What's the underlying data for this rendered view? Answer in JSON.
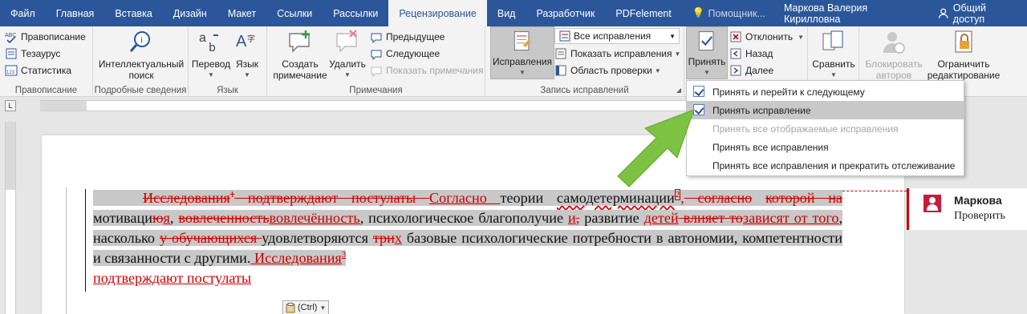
{
  "tabs": [
    "Файл",
    "Главная",
    "Вставка",
    "Дизайн",
    "Макет",
    "Ссылки",
    "Рассылки",
    "Рецензирование",
    "Вид",
    "Разработчик",
    "PDFelement"
  ],
  "active_tab": "Рецензирование",
  "help_placeholder": "Помощник...",
  "user_name": "Маркова Валерия Кирилловна",
  "share_label": "Общий доступ",
  "groups": {
    "spelling": {
      "label": "Правописание",
      "items": [
        "Правописание",
        "Тезаурус",
        "Статистика"
      ]
    },
    "insights": {
      "label": "Подробные сведения",
      "button": [
        "Интеллектуальный",
        "поиск"
      ]
    },
    "language": {
      "label": "Язык",
      "translate": "Перевод",
      "language": "Язык"
    },
    "comments": {
      "label": "Примечания",
      "create": [
        "Создать",
        "примечание"
      ],
      "delete": "Удалить",
      "prev": "Предыдущее",
      "next": "Следующее",
      "show": "Показать примечания"
    },
    "tracking": {
      "label": "Запись исправлений",
      "track_changes": "Исправления",
      "display_mode": "Все исправления",
      "show_markup": "Показать исправления",
      "reviewing_pane": "Область проверки"
    },
    "changes": {
      "accept": "Принять",
      "reject": "Отклонить",
      "previous": "Назад",
      "next": "Далее"
    },
    "compare": {
      "button": "Сравнить"
    },
    "protect": {
      "block_authors": [
        "Блокировать",
        "авторов"
      ],
      "restrict_editing": [
        "Ограничить",
        "редактирование"
      ]
    }
  },
  "accept_menu": {
    "items": [
      {
        "label": "Принять и перейти к следующему",
        "icon": "accept-icon",
        "disabled": false,
        "selected": false
      },
      {
        "label": "Принять исправление",
        "icon": "accept-icon",
        "disabled": false,
        "selected": true
      },
      {
        "label": "Принять все отображаемые исправления",
        "icon": "",
        "disabled": true,
        "selected": false
      },
      {
        "label": "Принять все исправления",
        "icon": "",
        "disabled": false,
        "selected": false
      },
      {
        "label": "Принять все исправления и прекратить отслеживание",
        "icon": "",
        "disabled": false,
        "selected": false
      }
    ]
  },
  "document": {
    "line1_del1": "Исследования",
    "line1_sup1": "1",
    "line1_del2": " подтверждают постулаты ",
    "line1_ins1": "Согласно ",
    "line1_t1": "теории ",
    "line1_t2": "самодетерминации",
    "line1_sup2": "2",
    "line1_ins2": ",",
    "line1_del3": " согласно",
    "line2_del1": "которой на",
    "line2_t1": " мотиваци",
    "line2_del2": "ю",
    "line2_ins1": "я",
    "line2_t2": ", ",
    "line2_del3": "вовлеченность",
    "line2_ins2": "вовлечённость",
    "line2_t3": ", психологическое благополучие ",
    "line2_ins3": "и",
    "line2_del4": ",",
    "line2_t4": " развитие",
    "line3_ins1": "детей",
    "line3_del1": " влияет то",
    "line3_ins2": "зависят от того",
    "line3_t1": ", насколько ",
    "line3_del2": "у обучающихся ",
    "line3_t2": "удовлетворяются ",
    "line3_del3": "три",
    "line3_ins3": "х",
    "line3_t3": " базовые",
    "line4_t1": "психологические потребности в автономии, компетентности и связанности с другими.",
    "line4_ins1": " Исследования",
    "line4_sup": "3",
    "line5_ins1": "подтверждают постулаты"
  },
  "paste_label": "(Ctrl)",
  "comment": {
    "author": "Маркова",
    "text": "Проверить"
  },
  "colors": {
    "ribbon_blue": "#2b579a",
    "revision_red": "#c00",
    "arrow_green": "#7dc242"
  }
}
